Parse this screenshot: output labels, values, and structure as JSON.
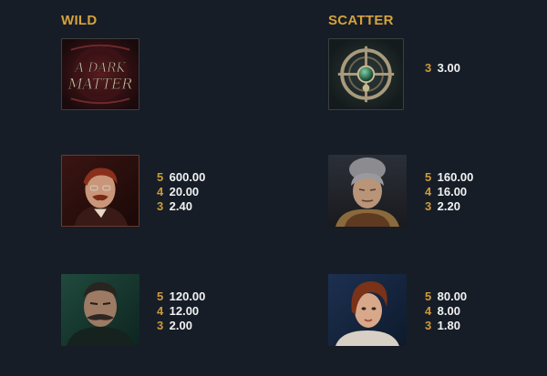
{
  "headings": {
    "wild": "WILD",
    "scatter": "SCATTER"
  },
  "wild_logo": {
    "line1": "A DARK",
    "line2": "MATTER"
  },
  "symbols": [
    {
      "name": "wild",
      "payouts": []
    },
    {
      "name": "scatter",
      "payouts": [
        {
          "count": "3",
          "amount": "3.00"
        }
      ]
    },
    {
      "name": "red-haired-man",
      "payouts": [
        {
          "count": "5",
          "amount": "600.00"
        },
        {
          "count": "4",
          "amount": "20.00"
        },
        {
          "count": "3",
          "amount": "2.40"
        }
      ]
    },
    {
      "name": "old-woman",
      "payouts": [
        {
          "count": "5",
          "amount": "160.00"
        },
        {
          "count": "4",
          "amount": "16.00"
        },
        {
          "count": "3",
          "amount": "2.20"
        }
      ]
    },
    {
      "name": "mustached-man",
      "payouts": [
        {
          "count": "5",
          "amount": "120.00"
        },
        {
          "count": "4",
          "amount": "12.00"
        },
        {
          "count": "3",
          "amount": "2.00"
        }
      ]
    },
    {
      "name": "young-woman",
      "payouts": [
        {
          "count": "5",
          "amount": "80.00"
        },
        {
          "count": "4",
          "amount": "8.00"
        },
        {
          "count": "3",
          "amount": "1.80"
        }
      ]
    }
  ],
  "colors": {
    "background": "#161d27",
    "heading": "#d6a23c",
    "count": "#cf9a3a",
    "amount": "#f2f2f2"
  }
}
